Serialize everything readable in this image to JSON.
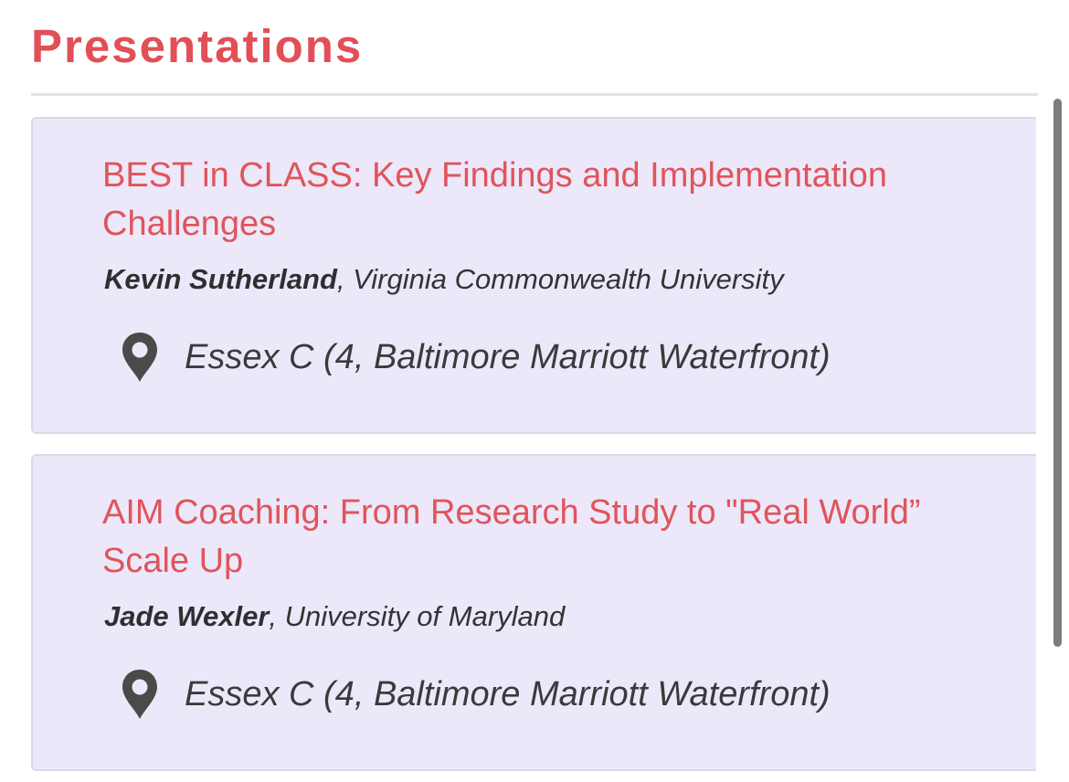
{
  "page": {
    "title": "Presentations"
  },
  "presentations": [
    {
      "title": "BEST in CLASS: Key Findings and Implementation Challenges",
      "author": "Kevin Sutherland",
      "affiliation": ", Virginia Commonwealth University",
      "location_icon": "map-pin-icon",
      "location": "Essex C (4, Baltimore Marriott Waterfront)"
    },
    {
      "title": "AIM Coaching: From Research Study to \"Real World” Scale Up",
      "author": "Jade Wexler",
      "affiliation": ", University of Maryland",
      "location_icon": "map-pin-icon",
      "location": "Essex C (4, Baltimore Marriott Waterfront)"
    }
  ],
  "colors": {
    "accent": "#e24f57",
    "card_background": "#ece8fa",
    "text": "#333333"
  }
}
